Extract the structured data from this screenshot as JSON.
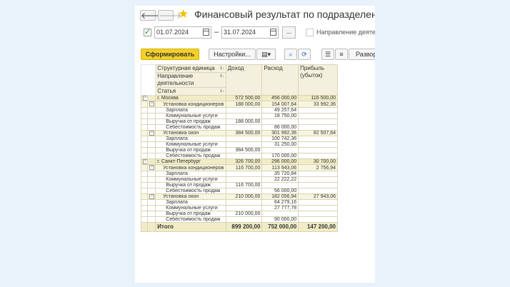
{
  "header": {
    "title": "Финансовый результат по подразделениям"
  },
  "filter": {
    "date_from": "01.07.2024",
    "date_to": "31.07.2024",
    "dash": "–",
    "dots_label": "...",
    "direction_label": "Направление деятельности"
  },
  "toolbar": {
    "generate_label": "Сформировать",
    "settings_label": "Настройки...",
    "expand_label": "Развор"
  },
  "table": {
    "headers": {
      "col1_a": "Структурная единица",
      "col1_b": "Направление деятельности",
      "col1_c": "Статья",
      "income": "Доход",
      "expense": "Расход",
      "profit": "Прибыль (убыток)"
    },
    "rows": [
      {
        "level": 0,
        "label": "г. Москва",
        "income": "572 500,00",
        "expense": "456 000,00",
        "profit": "116 500,00"
      },
      {
        "level": 1,
        "label": "Установка кондиционеров",
        "income": "188 000,00",
        "expense": "154 007,64",
        "profit": "33 992,36"
      },
      {
        "level": 2,
        "label": "Зарплата",
        "income": "",
        "expense": "49 257,64",
        "profit": ""
      },
      {
        "level": 2,
        "label": "Коммунальные услуги",
        "income": "",
        "expense": "18 750,00",
        "profit": ""
      },
      {
        "level": 2,
        "label": "Выручка от продаж",
        "income": "188 000,00",
        "expense": "",
        "profit": ""
      },
      {
        "level": 2,
        "label": "Себестоимость продаж",
        "income": "",
        "expense": "86 000,00",
        "profit": ""
      },
      {
        "level": 1,
        "label": "Установка окон",
        "income": "384 500,00",
        "expense": "301 992,36",
        "profit": "82 507,64"
      },
      {
        "level": 2,
        "label": "Зарплата",
        "income": "",
        "expense": "100 742,36",
        "profit": ""
      },
      {
        "level": 2,
        "label": "Коммунальные услуги",
        "income": "",
        "expense": "31 250,00",
        "profit": ""
      },
      {
        "level": 2,
        "label": "Выручка от продаж",
        "income": "384 500,00",
        "expense": "",
        "profit": ""
      },
      {
        "level": 2,
        "label": "Себестоимость продаж",
        "income": "",
        "expense": "170 000,00",
        "profit": ""
      },
      {
        "level": 0,
        "label": "г. Санкт-Петербург",
        "income": "326 700,00",
        "expense": "296 000,00",
        "profit": "30 700,00"
      },
      {
        "level": 1,
        "label": "Установка кондиционеров",
        "income": "116 700,00",
        "expense": "113 943,06",
        "profit": "2 756,94"
      },
      {
        "level": 2,
        "label": "Зарплата",
        "income": "",
        "expense": "35 720,84",
        "profit": ""
      },
      {
        "level": 2,
        "label": "Коммунальные услуги",
        "income": "",
        "expense": "22 222,22",
        "profit": ""
      },
      {
        "level": 2,
        "label": "Выручка от продаж",
        "income": "116 700,00",
        "expense": "",
        "profit": ""
      },
      {
        "level": 2,
        "label": "Себестоимость продаж",
        "income": "",
        "expense": "56 000,00",
        "profit": ""
      },
      {
        "level": 1,
        "label": "Установка окон",
        "income": "210 000,00",
        "expense": "182 056,94",
        "profit": "27 943,06"
      },
      {
        "level": 2,
        "label": "Зарплата",
        "income": "",
        "expense": "64 279,16",
        "profit": ""
      },
      {
        "level": 2,
        "label": "Коммунальные услуги",
        "income": "",
        "expense": "27 777,78",
        "profit": ""
      },
      {
        "level": 2,
        "label": "Выручка от продаж",
        "income": "210 000,00",
        "expense": "",
        "profit": ""
      },
      {
        "level": 2,
        "label": "Себестоимость продаж",
        "income": "",
        "expense": "90 000,00",
        "profit": ""
      }
    ],
    "total": {
      "label": "Итого",
      "income": "899 200,00",
      "expense": "752 000,00",
      "profit": "147 200,00"
    }
  },
  "icons": {
    "back": "back-arrow-icon",
    "forward": "forward-arrow-icon",
    "favorite": "star-icon",
    "calendar": "calendar-icon",
    "variant": "report-variant-icon",
    "search": "search-icon",
    "search_next": "search-next-icon",
    "structure": "structure-icon",
    "expand_all": "expand-all-icon"
  },
  "colors": {
    "accent_button": "#f3d12a",
    "group_row": "#f1ecc5",
    "subgroup_row": "#f8f5de",
    "page_bg": "#e9f1fb",
    "favorite_star": "#f2c200"
  }
}
